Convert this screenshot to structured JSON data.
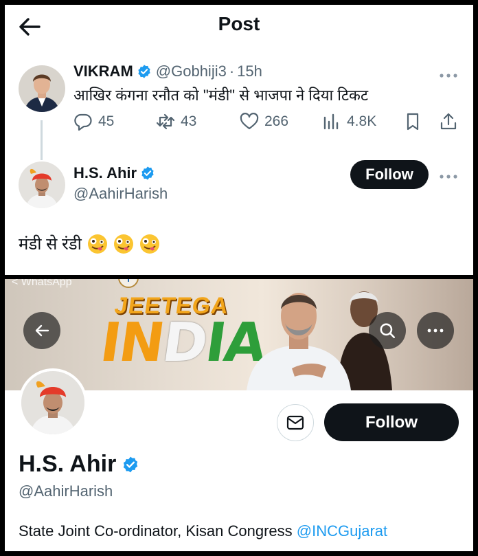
{
  "header": {
    "title": "Post"
  },
  "original_tweet": {
    "name": "VIKRAM",
    "handle": "@Gobhiji3",
    "separator": "·",
    "time": "15h",
    "text": "आखिर कंगना रनौत को \"मंडी\" से भाजपा ने दिया टिकट",
    "replies": "45",
    "retweets": "43",
    "likes": "266",
    "views": "4.8K"
  },
  "reply": {
    "name": "H.S. Ahir",
    "handle": "@AahirHarish",
    "follow_label": "Follow",
    "text": "मंडी से रंडी",
    "emojis": [
      "zany-face",
      "zany-face",
      "zany-face"
    ]
  },
  "banner": {
    "app_label": "< WhatsApp",
    "slogan_top": "JEETEGA",
    "slogan_main": [
      "IN",
      "D",
      "IA"
    ]
  },
  "profile": {
    "name": "H.S. Ahir",
    "handle": "@AahirHarish",
    "follow_label": "Follow",
    "bio_text": "State Joint Co-ordinator, Kisan Congress ",
    "bio_link": "@INCGujarat"
  },
  "colors": {
    "verified_blue": "#1d9bf0",
    "text_primary": "#0f1419",
    "text_secondary": "#536471",
    "button_dark": "#0f1419",
    "saffron": "#f39c12",
    "green": "#2e9e3a"
  }
}
